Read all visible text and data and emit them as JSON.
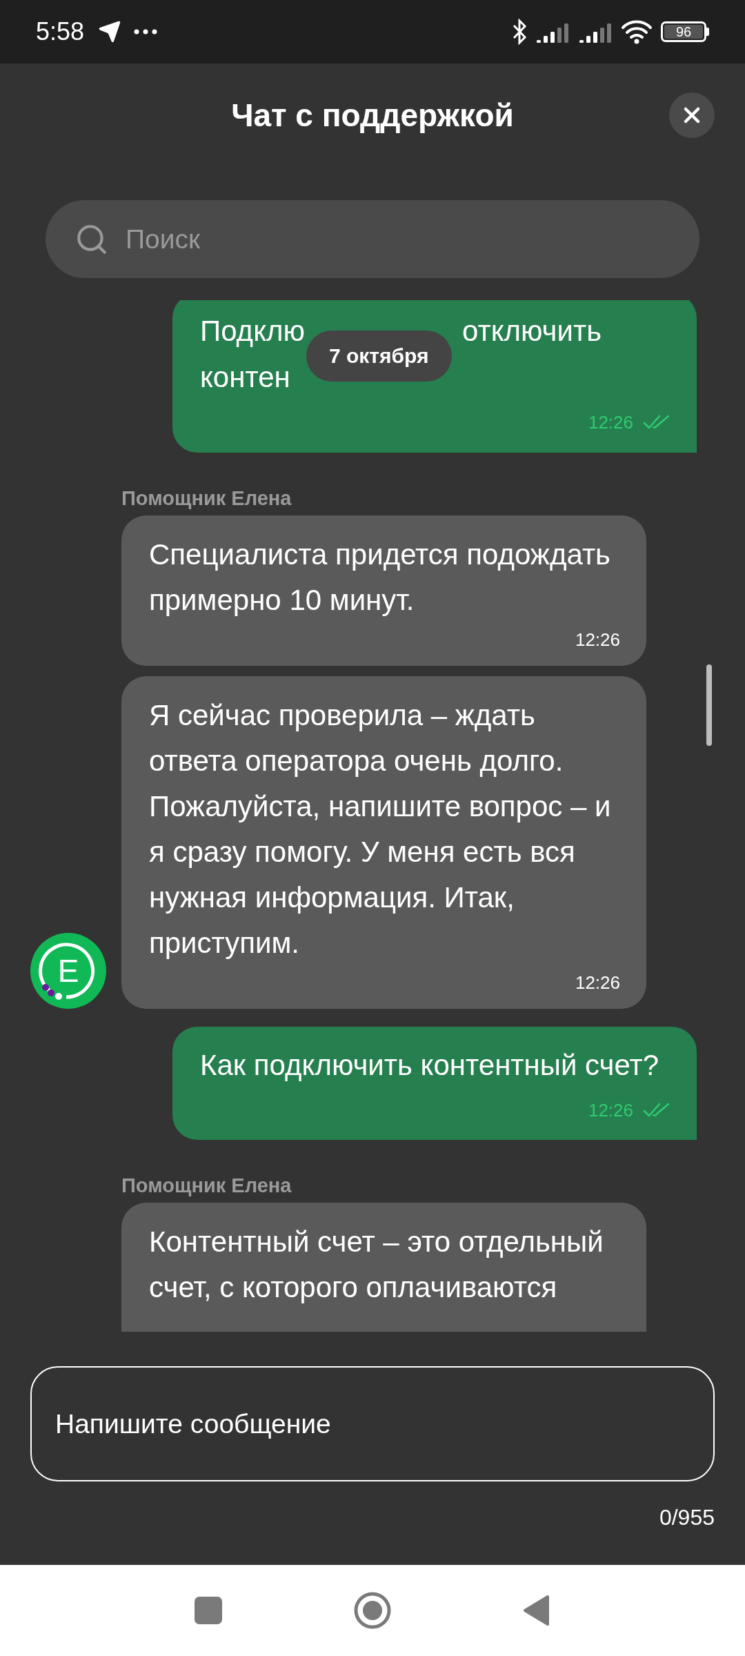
{
  "status_bar": {
    "time": "5:58",
    "battery": "96"
  },
  "header": {
    "title": "Чат с поддержкой"
  },
  "search": {
    "placeholder": "Поиск"
  },
  "date_chip": "7 октября",
  "messages": [
    {
      "kind": "outgoing",
      "lines": [
        [
          "Подклю",
          "отключить"
        ],
        [
          "контен"
        ]
      ],
      "time": "12:26",
      "read": true
    },
    {
      "kind": "incoming",
      "sender": "Помощник Елена",
      "text": "Специалиста придется подождать примерно 10 минут.",
      "time": "12:26"
    },
    {
      "kind": "incoming",
      "text": "Я сейчас проверила – ждать ответа оператора очень долго. Пожалуйста, напишите вопрос – и я сразу помогу. У меня есть вся нужная информация. Итак, приступим.",
      "time": "12:26",
      "avatar": "Е"
    },
    {
      "kind": "outgoing",
      "text": "Как подключить контентный счет?",
      "time": "12:26",
      "read": true
    },
    {
      "kind": "incoming",
      "sender": "Помощник Елена",
      "text": "Контентный счет – это отдельный счет, с которого оплачиваются"
    }
  ],
  "composer": {
    "placeholder": "Напишите сообщение",
    "counter": "0/955"
  }
}
